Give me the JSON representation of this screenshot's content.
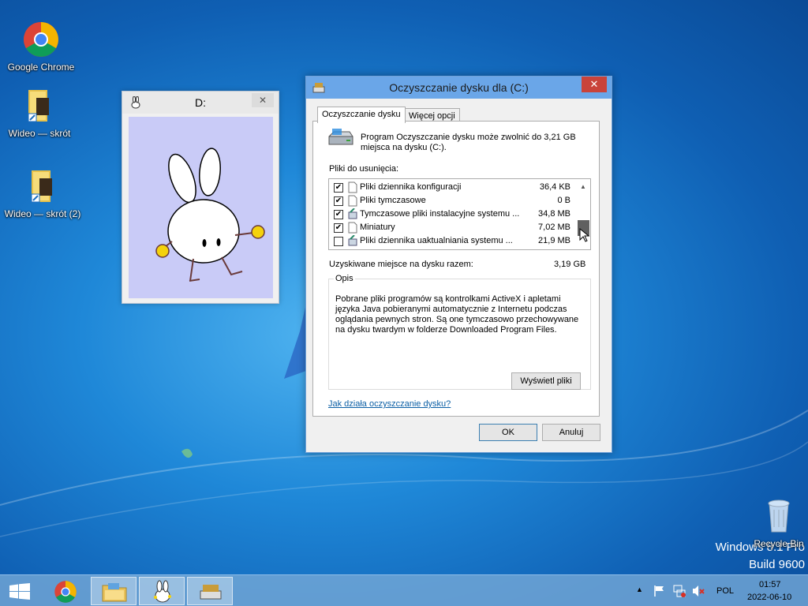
{
  "desktop": {
    "icons": [
      {
        "label": "Google Chrome"
      },
      {
        "label": "Wideo — skrót"
      },
      {
        "label": "Wideo — skrót (2)"
      },
      {
        "label": "Recycle Bin"
      }
    ],
    "watermark": {
      "line1": "Windows 8.1 Pro",
      "line2": "Build 9600"
    }
  },
  "d_window": {
    "title": "D:",
    "close": "✕"
  },
  "dialog": {
    "title": "Oczyszczanie dysku dla  (C:)",
    "close": "✕",
    "tabs": [
      "Oczyszczanie dysku",
      "Więcej opcji"
    ],
    "intro": "Program Oczyszczanie dysku może zwolnić do 3,21 GB miejsca na dysku  (C:).",
    "files_label": "Pliki do usunięcia:",
    "files": [
      {
        "name": "Pliki dziennika konfiguracji",
        "size": "36,4 KB",
        "checked": true
      },
      {
        "name": "Pliki tymczasowe",
        "size": "0 B",
        "checked": true
      },
      {
        "name": "Tymczasowe pliki instalacyjne systemu ...",
        "size": "34,8 MB",
        "checked": true
      },
      {
        "name": "Miniatury",
        "size": "7,02 MB",
        "checked": true
      },
      {
        "name": "Pliki dziennika uaktualniania systemu ...",
        "size": "21,9 MB",
        "checked": false
      }
    ],
    "total_label": "Uzyskiwane miejsce na dysku razem:",
    "total_value": "3,19 GB",
    "desc_legend": "Opis",
    "desc_text": "Pobrane pliki programów są kontrolkami ActiveX i apletami języka Java pobieranymi automatycznie z Internetu podczas oglądania pewnych stron. Są one tymczasowo przechowywane na dysku twardym w folderze Downloaded Program Files.",
    "view_files": "Wyświetl pliki",
    "help_link": "Jak działa oczyszczanie dysku?",
    "ok": "OK",
    "cancel": "Anuluj"
  },
  "taskbar": {
    "language": "POL",
    "time": "01:57",
    "date": "2022-06-10"
  }
}
